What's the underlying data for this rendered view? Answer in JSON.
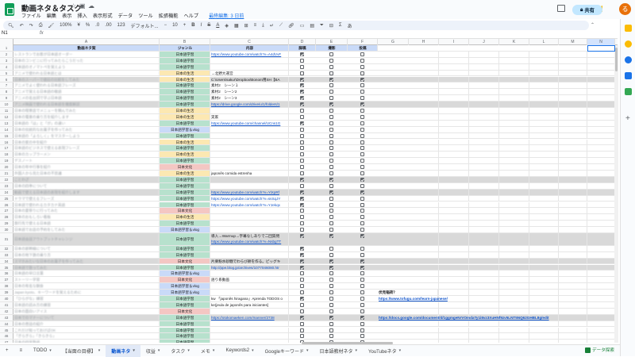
{
  "header": {
    "title": "動画ネタ＆タスク",
    "last_edit": "最終編集: 3 日前",
    "share_label": "共有",
    "avatar_letter": "る",
    "menus": [
      "ファイル",
      "編集",
      "表示",
      "挿入",
      "表示形式",
      "データ",
      "ツール",
      "拡張機能",
      "ヘルプ"
    ]
  },
  "toolbar": {
    "zoom": "100%",
    "currency": "¥",
    "percent": "%",
    "dec1": ".0",
    "dec2": ".00",
    "format": "123",
    "font": "デフォルト...",
    "font_size": "10",
    "bold": "B",
    "italic": "I",
    "strike": "S",
    "text_color": "A"
  },
  "formula": {
    "namebox": "N1",
    "fx": "fx"
  },
  "columns": [
    "A",
    "B",
    "C",
    "D",
    "E",
    "F",
    "G",
    "H",
    "I",
    "J",
    "K",
    "L",
    "M",
    "N"
  ],
  "header_row": {
    "a": "動画ネタ案",
    "b": "ジャンル",
    "c": "内容",
    "d": "脚稿",
    "e": "撮影",
    "f": "投稿"
  },
  "rows": [
    {
      "n": "2",
      "a": "レストランでお客が日本語オーダー",
      "b": "日本語学習",
      "c": "https://www.youtube.com/watch?v=A4dVvF",
      "link": true,
      "d": 1,
      "e": 0,
      "f": 0
    },
    {
      "n": "3",
      "a": "日本のコンビニに行ってみたらこうだった",
      "b": "日本語学習",
      "c": "",
      "d": 0,
      "e": 0,
      "f": 0
    },
    {
      "n": "4",
      "a": "日本語のオノマトペを覚えよう",
      "b": "日本語学習",
      "c": "",
      "d": 0,
      "e": 0,
      "f": 0
    },
    {
      "n": "5",
      "a": "アニメで使われる日本語とは",
      "b": "日本の生活",
      "c": "→北野大運営",
      "d": 0,
      "e": 0,
      "f": 0
    },
    {
      "n": "6",
      "a": "日本のスーパーで値段の比較をしてみた",
      "b": "日本の生活",
      "c": "C:\\Users\\sakur\\Dropbox\\Bonom用SH【BA",
      "gray": true,
      "d": 1,
      "e": 1,
      "f": 1
    },
    {
      "n": "7",
      "a": "アニメでよく使われる日本語フレーズ",
      "b": "日本語学習",
      "c": "素材2　シーン１",
      "d": 1,
      "e": 0,
      "f": 0
    },
    {
      "n": "8",
      "a": "アニメで覚える日本語の敬語",
      "b": "日本語学習",
      "c": "素材2　シーン2",
      "d": 1,
      "e": 0,
      "f": 0
    },
    {
      "n": "9",
      "a": "アニメの名台詞で学ぶ日本語",
      "b": "日本語学習",
      "c": "素材2　シーン3",
      "d": 1,
      "e": 0,
      "f": 0
    },
    {
      "n": "10",
      "a": "アニメ映画で使われる日本語を徹底解説",
      "b": "日本語学習",
      "c": "https://drive.google.com/drive/u/1/folders/1",
      "link": true,
      "gray": true,
      "d": 1,
      "e": 1,
      "f": 1
    },
    {
      "n": "11",
      "a": "日本の喫茶店でメニューを頼んでみた",
      "b": "日本の生活",
      "c": "",
      "d": 0,
      "e": 0,
      "f": 0
    },
    {
      "n": "12",
      "a": "日本の電車の乗り方を紹介します",
      "b": "日本の生活",
      "c": "実家",
      "d": 0,
      "e": 0,
      "f": 0
    },
    {
      "n": "13",
      "a": "日本語の「は」と「が」の違い",
      "b": "日本語学習",
      "c": "https://www.youtube.com/channel/UCns1G",
      "link": true,
      "d": 1,
      "e": 0,
      "f": 0
    },
    {
      "n": "14",
      "a": "日本の伝統的なお菓子を作ってみた",
      "b": "日本語学習＆vlog",
      "c": "",
      "d": 0,
      "e": 0,
      "f": 0
    },
    {
      "n": "15",
      "a": "日本語の「よろしく」をマスターしよう",
      "b": "日本語学習",
      "c": "",
      "d": 0,
      "e": 0,
      "f": 0
    },
    {
      "n": "16",
      "a": "日本の家の中を紹介",
      "b": "日本の生活",
      "c": "",
      "d": 0,
      "e": 0,
      "f": 0
    },
    {
      "n": "17",
      "a": "日本語のビジネスで使える表現フレーズ",
      "b": "日本語学習",
      "c": "",
      "d": 0,
      "e": 0,
      "f": 0
    },
    {
      "n": "18",
      "a": "日本のカップラーメン",
      "b": "日本の生活",
      "c": "",
      "d": 0,
      "e": 0,
      "f": 0
    },
    {
      "n": "19",
      "a": "デスノート",
      "b": "日本語学習",
      "c": "",
      "d": 0,
      "e": 0,
      "f": 0
    },
    {
      "n": "20",
      "a": "日本の年中行事を紹介",
      "b": "日本文化",
      "c": "",
      "d": 0,
      "e": 0,
      "f": 0
    },
    {
      "n": "21",
      "a": "外国人から見た日本の不思議",
      "b": "日本の生活",
      "c": "japonês comida estrenha",
      "d": 0,
      "e": 0,
      "f": 0
    },
    {
      "n": "22",
      "a": "ことわざ",
      "b": "日本語学習",
      "c": "",
      "gray": true,
      "d": 1,
      "e": 1,
      "f": 1
    },
    {
      "n": "23",
      "a": "日本の四季について",
      "b": "日本語学習",
      "c": "",
      "d": 0,
      "e": 0,
      "f": 0
    },
    {
      "n": "24",
      "a": "動画で使える日本語の表現を紹介します",
      "b": "日本語学習",
      "c": "https://www.youtube.com/watch?v=YiXpRf",
      "link": true,
      "gray": true,
      "d": 1,
      "e": 1,
      "f": 1
    },
    {
      "n": "25",
      "a": "ドラマで使えるフレーズ",
      "b": "日本語学習",
      "c": "https://www.youtube.com/watch?v=ssSqJY",
      "link": true,
      "d": 1,
      "e": 0,
      "f": 0
    },
    {
      "n": "26",
      "a": "日本語で使われるカタカナ英語",
      "b": "日本語学習",
      "c": "https://www.youtube.com/watch?v=YJekqx",
      "link": true,
      "d": 1,
      "e": 0,
      "f": 0
    },
    {
      "n": "27",
      "a": "日本の夏祭りに行ってみた",
      "b": "日本文化",
      "c": "",
      "d": 0,
      "e": 0,
      "f": 0
    },
    {
      "n": "28",
      "a": "日本のおもしろい看板",
      "b": "日本の生活",
      "c": "",
      "d": 0,
      "e": 0,
      "f": 0
    },
    {
      "n": "29",
      "a": "旅行先で使える日本語",
      "b": "日本語学習",
      "c": "",
      "d": 0,
      "e": 0,
      "f": 0
    },
    {
      "n": "30",
      "a": "日本語でお店の予約をしてみた",
      "b": "日本語学習＆vlog",
      "c": "",
      "d": 0,
      "e": 0,
      "f": 0
    },
    {
      "n": "31",
      "a": "日本語会話アウトプットチャレンジ",
      "b": "日本語学習",
      "c": "導入→Warmup→字幕なしありで二回質問",
      "c2": "https://www.youtube.com/watch?v=NsbgTT",
      "gray": true,
      "tall": true,
      "d": 1,
      "e": 1,
      "f": 1
    },
    {
      "n": "32",
      "a": "日本の新幹線について",
      "b": "日本語学習",
      "c": "",
      "d": 1,
      "e": 0,
      "f": 0
    },
    {
      "n": "33",
      "a": "日本の地下鉄の乗り方",
      "b": "日本語学習",
      "c": "",
      "d": 1,
      "e": 0,
      "f": 0
    },
    {
      "n": "34",
      "a": "スマホみたいな日本のお菓子を作ってみた",
      "b": "日本文化",
      "c": "片栗粉水砂糖でわらび餅を作る。ピッグキ",
      "gray": true,
      "d": 1,
      "e": 1,
      "f": 1
    },
    {
      "n": "35",
      "a": "日本語で歌ってみた",
      "b": "日本語学習",
      "c": "http://ppe.blog.jp/archives/1077046080.htr",
      "link": true,
      "gray": true,
      "d": 1,
      "e": 1,
      "f": 1
    },
    {
      "n": "36",
      "a": "日本語の早口言葉",
      "b": "日本語学習＆vlog",
      "c": "",
      "d": 0,
      "e": 0,
      "f": 0
    },
    {
      "n": "37",
      "a": "ストーリー学習",
      "b": "日本文化",
      "c": "語り系動画",
      "d": 0,
      "e": 0,
      "f": 0
    },
    {
      "n": "38",
      "a": "日本の有名な朝食",
      "b": "日本語学習＆vlog",
      "c": "",
      "d": 0,
      "e": 0,
      "f": 0
    },
    {
      "n": "39",
      "a": "Japan kyoto、キーワードを覚えるために",
      "b": "日本語学習＆vlog",
      "c": "",
      "d": 0,
      "e": 0,
      "f": 0,
      "g": "伏見稲荷？"
    },
    {
      "n": "40",
      "a": "「ひらがな」練習",
      "b": "日本語学習",
      "c": "kw 「japonês hiragana」Aprenda TODOS o",
      "d": 1,
      "e": 0,
      "f": 0,
      "g": "https://www.tofugu.com/learn-japanese/",
      "glink": true
    },
    {
      "n": "41",
      "a": "日本語の読み方の練習",
      "b": "日本語学習",
      "c": "ke(jeula de japonês para iniciantes]",
      "d": 0,
      "e": 0,
      "f": 0
    },
    {
      "n": "42",
      "a": "日本の面白いアイス",
      "b": "日本文化",
      "c": "",
      "d": 0,
      "e": 0,
      "f": 0
    },
    {
      "n": "43",
      "a": "日本でのマナーについて",
      "b": "日本語学習",
      "c": "https://otokomaeken.com/manner/2738",
      "link": true,
      "gray": true,
      "d": 1,
      "e": 1,
      "f": 1,
      "g": "https://docs.google.com/document/d/1ggmgeNrVOmdaTy1i8vz3XuHNf9zv5LNT5NQ62GHBL8g/edit",
      "glink": true
    },
    {
      "n": "44",
      "a": "日本の昔話の紹介",
      "b": "日本語学習",
      "c": "",
      "d": 0,
      "e": 0,
      "f": 0
    },
    {
      "n": "45",
      "a": "これだけ知っておけばOK",
      "b": "日本語学習",
      "c": "",
      "d": 0,
      "e": 0,
      "f": 0
    },
    {
      "n": "46",
      "a": "「ぎらぎら」「きらきら」",
      "b": "日本語学習",
      "c": "",
      "d": 0,
      "e": 0,
      "f": 0
    },
    {
      "n": "47",
      "a": "日本の四字熟語",
      "b": "日本語学習",
      "c": "",
      "d": 0,
      "e": 0,
      "f": 0
    }
  ],
  "genre_colors": {
    "日本語学習": "#b7e1cd",
    "日本の生活": "#fce8b2",
    "日本文化": "#f4c7c3",
    "日本語学習＆vlog": "#c9daf8"
  },
  "tabs": [
    {
      "label": "TODO"
    },
    {
      "label": "【当面の目標】"
    },
    {
      "label": "動画ネタ",
      "active": true
    },
    {
      "label": "収益"
    },
    {
      "label": "タスク"
    },
    {
      "label": "メモ"
    },
    {
      "label": "Keywords2"
    },
    {
      "label": "Googleキーワード"
    },
    {
      "label": "日本語教材ネタ"
    },
    {
      "label": "YouTubeネタ"
    }
  ],
  "explore_label": "データ探索"
}
